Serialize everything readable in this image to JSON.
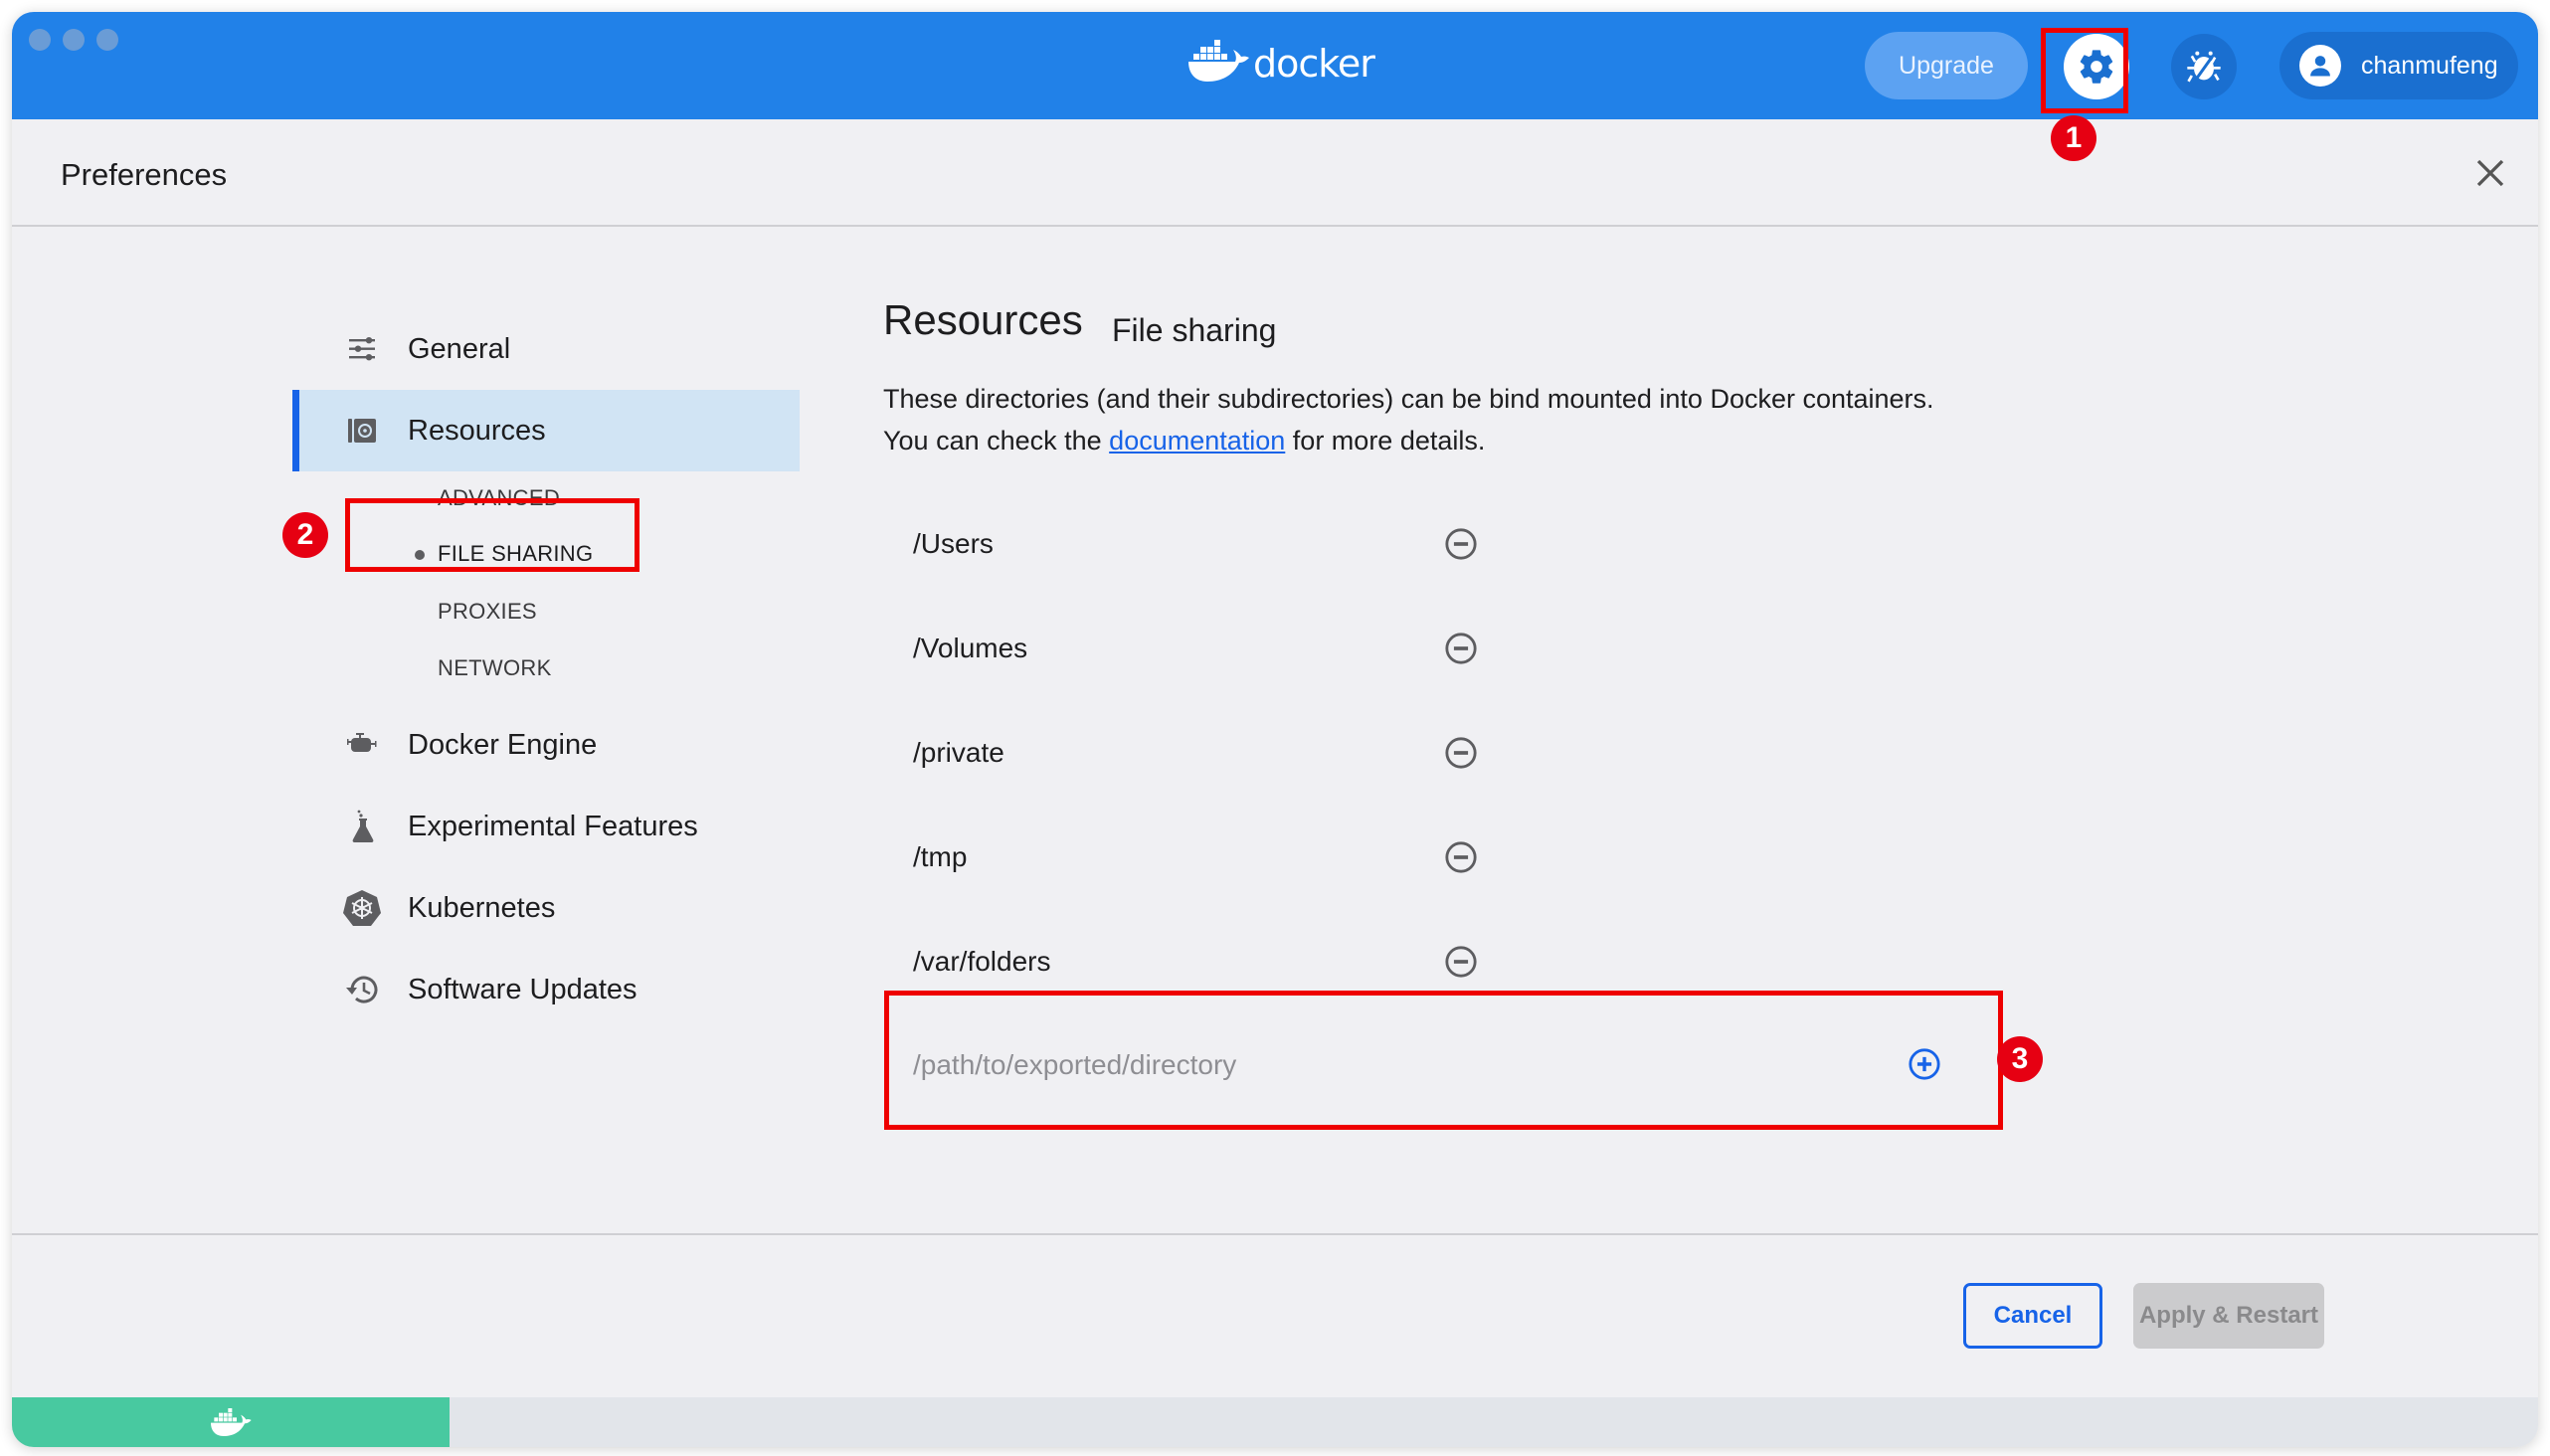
{
  "app": {
    "brand": "docker",
    "accent_color": "#2181e8",
    "engine_status_color": "#48c9a0"
  },
  "titlebar": {
    "upgrade_label": "Upgrade",
    "settings_icon": "gear-icon",
    "troubleshoot_icon": "bug-icon",
    "user_name": "chanmufeng"
  },
  "header": {
    "title": "Preferences",
    "close_icon": "close-icon"
  },
  "sidebar": {
    "items": [
      {
        "label": "General",
        "icon": "sliders-icon"
      },
      {
        "label": "Resources",
        "icon": "resources-icon",
        "active": true
      },
      {
        "label": "Docker Engine",
        "icon": "engine-icon"
      },
      {
        "label": "Experimental Features",
        "icon": "flask-icon"
      },
      {
        "label": "Kubernetes",
        "icon": "kubernetes-icon"
      },
      {
        "label": "Software Updates",
        "icon": "history-icon"
      }
    ],
    "resources_subitems": [
      {
        "label": "ADVANCED"
      },
      {
        "label": "FILE SHARING",
        "selected": true
      },
      {
        "label": "PROXIES"
      },
      {
        "label": "NETWORK"
      }
    ]
  },
  "main": {
    "title": "Resources",
    "subtitle": "File sharing",
    "description_before": "These directories (and their subdirectories) can be bind mounted into Docker containers. You can check the ",
    "description_link": "documentation",
    "description_after": " for more details.",
    "directories": [
      {
        "path": "/Users"
      },
      {
        "path": "/Volumes"
      },
      {
        "path": "/private"
      },
      {
        "path": "/tmp"
      },
      {
        "path": "/var/folders"
      }
    ],
    "new_directory": {
      "value": "",
      "placeholder": "/path/to/exported/directory"
    }
  },
  "footer": {
    "cancel_label": "Cancel",
    "apply_label": "Apply & Restart"
  },
  "annotations": [
    {
      "number": "1",
      "target": "settings button"
    },
    {
      "number": "2",
      "target": "FILE SHARING"
    },
    {
      "number": "3",
      "target": "add directory input"
    }
  ]
}
